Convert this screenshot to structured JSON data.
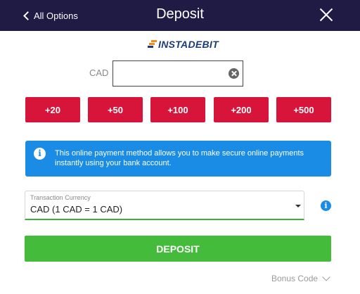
{
  "header": {
    "back_label": "All Options",
    "title": "Deposit"
  },
  "provider": {
    "logo_text": "INSTADEBIT"
  },
  "amount": {
    "currency_label": "CAD",
    "value": "",
    "placeholder": ""
  },
  "quick_amounts": [
    "+20",
    "+50",
    "+100",
    "+200",
    "+500"
  ],
  "info_banner": {
    "text": "This online payment method allows you to make secure online payments instantly using your bank account."
  },
  "currency_select": {
    "label": "Transaction Currency",
    "value": "CAD (1 CAD = 1 CAD)"
  },
  "deposit_button": {
    "label": "DEPOSIT"
  },
  "bonus": {
    "label": "Bonus Code"
  },
  "colors": {
    "header_bg": "#1f1b45",
    "quick_amount_bg": "#d7143a",
    "info_bg": "#1a8ce5",
    "deposit_bg": "#44bb3a",
    "select_underline": "#3bb03b"
  }
}
